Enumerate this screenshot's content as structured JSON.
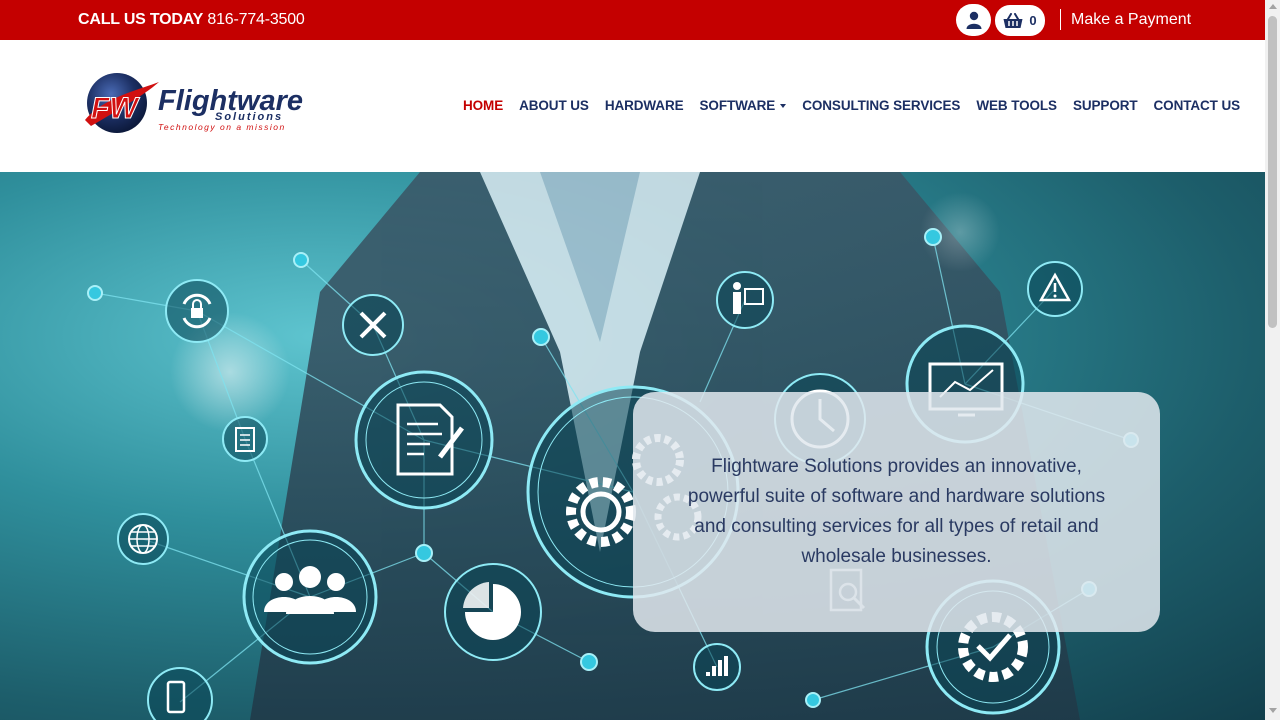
{
  "topbar": {
    "call_label": "CALL US TODAY",
    "phone": "816-774-3500",
    "user_icon": "user-icon",
    "cart_icon": "shopping-basket-icon",
    "cart_count": "0",
    "payment_link": "Make a Payment",
    "bg_color": "#c40000"
  },
  "logo": {
    "name": "Flightware",
    "sub": "Solutions",
    "tagline": "Technology on a mission",
    "monogram": "FW"
  },
  "nav": {
    "items": [
      {
        "label": "HOME",
        "active": true
      },
      {
        "label": "ABOUT US"
      },
      {
        "label": "HARDWARE"
      },
      {
        "label": "SOFTWARE",
        "dropdown": true
      },
      {
        "label": "CONSULTING SERVICES"
      },
      {
        "label": "WEB TOOLS"
      },
      {
        "label": "SUPPORT"
      },
      {
        "label": "CONTACT US"
      }
    ],
    "text_color": "#1c2f63",
    "active_color": "#c40000"
  },
  "hero": {
    "tagline": "Flightware Solutions provides an innovative, powerful suite of software and hardware solutions and consulting services for all types of retail and wholesale businesses.",
    "icons": [
      "lock-refresh-icon",
      "tools-icon",
      "presenter-icon",
      "warning-icon",
      "document-icon",
      "clock-icon",
      "monitor-chart-icon",
      "gears-icon",
      "globe-icon",
      "users-icon",
      "pie-chart-icon",
      "bar-chart-icon",
      "checkmark-gear-icon",
      "mobile-icon",
      "search-document-icon"
    ]
  }
}
